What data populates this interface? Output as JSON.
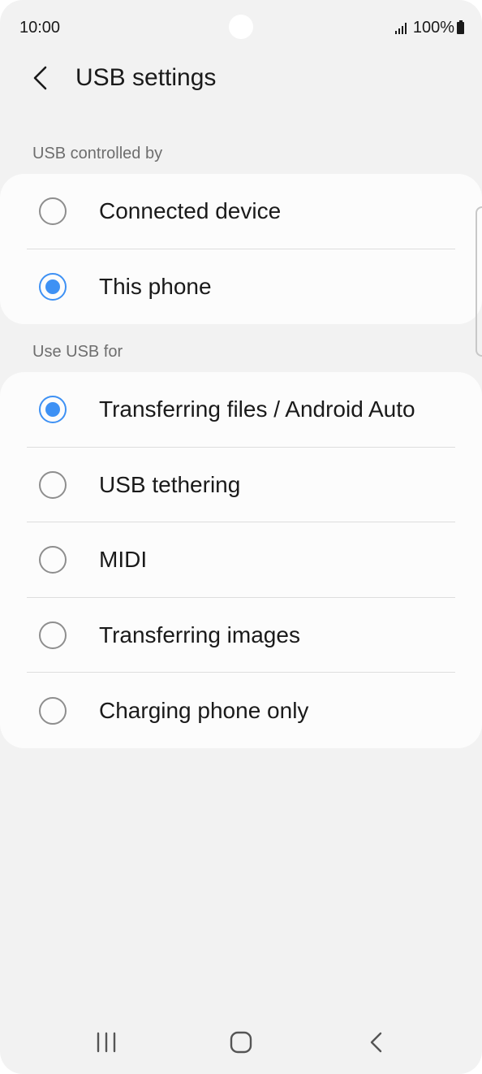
{
  "status_bar": {
    "time": "10:00",
    "battery": "100%",
    "icons": [
      "signal-icon",
      "battery-icon"
    ]
  },
  "header": {
    "title": "USB settings",
    "back_icon": "back-arrow-icon"
  },
  "usb_controlled_by": {
    "label": "USB controlled by",
    "options": [
      {
        "label": "Connected device",
        "selected": false
      },
      {
        "label": "This phone",
        "selected": true
      }
    ]
  },
  "use_usb_for": {
    "label": "Use USB for",
    "options": [
      {
        "label": "Transferring files / Android Auto",
        "selected": true
      },
      {
        "label": "USB tethering",
        "selected": false
      },
      {
        "label": "MIDI",
        "selected": false
      },
      {
        "label": "Transferring images",
        "selected": false
      },
      {
        "label": "Charging phone only",
        "selected": false
      }
    ]
  },
  "nav_bar": {
    "icons": [
      "recents-icon",
      "home-icon",
      "back-icon"
    ]
  },
  "colors": {
    "accent": "#3e91f4",
    "background": "#f2f2f2",
    "card": "#fcfcfc",
    "text": "#1a1a1a",
    "secondary_text": "#6e6e6e"
  }
}
